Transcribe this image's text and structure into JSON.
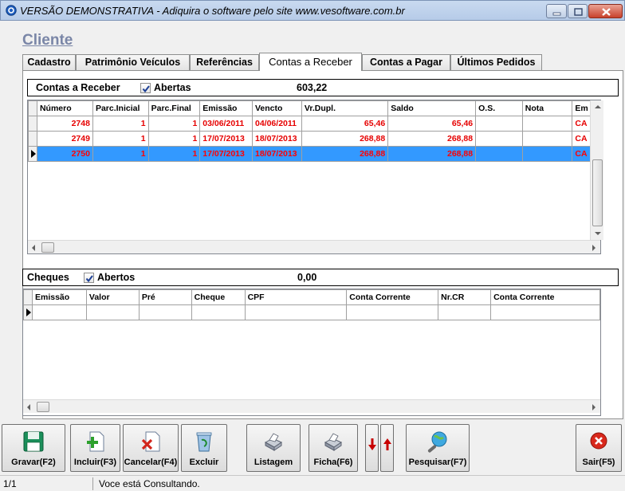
{
  "window": {
    "title": "VERSÃO DEMONSTRATIVA - Adiquira o software pelo site www.vesoftware.com.br",
    "icons": [
      "app-icon",
      "minimize-icon",
      "maximize-icon",
      "close-icon"
    ]
  },
  "page_title": "Cliente",
  "tabs": [
    {
      "label": "Cadastro",
      "active": false
    },
    {
      "label": "Patrimônio Veículos",
      "active": false
    },
    {
      "label": "Referências",
      "active": false
    },
    {
      "label": "Contas a Receber",
      "active": true
    },
    {
      "label": "Contas a Pagar",
      "active": false
    },
    {
      "label": "Últimos Pedidos",
      "active": false
    }
  ],
  "receivables": {
    "label": "Contas a Receber",
    "checkbox_label": "Abertas",
    "checked": true,
    "total": "603,22",
    "columns": [
      "Número",
      "Parc.Inicial",
      "Parc.Final",
      "Emissão",
      "Vencto",
      "Vr.Dupl.",
      "Saldo",
      "O.S.",
      "Nota",
      "Em"
    ],
    "rows": [
      [
        "2748",
        "1",
        "1",
        "03/06/2011",
        "04/06/2011",
        "65,46",
        "65,46",
        "",
        "",
        "CA"
      ],
      [
        "2749",
        "1",
        "1",
        "17/07/2013",
        "18/07/2013",
        "268,88",
        "268,88",
        "",
        "",
        "CA"
      ],
      [
        "2750",
        "1",
        "1",
        "17/07/2013",
        "18/07/2013",
        "268,88",
        "268,88",
        "",
        "",
        "CA"
      ]
    ],
    "selected_row": 2
  },
  "cheques": {
    "label": "Cheques",
    "checkbox_label": "Abertos",
    "checked": true,
    "total": "0,00",
    "columns": [
      "Emissão",
      "Valor",
      "Pré",
      "Cheque",
      "CPF",
      "Conta Corrente",
      "Nr.CR",
      "Conta Corrente"
    ]
  },
  "toolbar": {
    "save": "Gravar(F2)",
    "insert": "Incluir(F3)",
    "cancel": "Cancelar(F4)",
    "delete": "Excluir",
    "list": "Listagem",
    "sheet": "Ficha(F6)",
    "search": "Pesquisar(F7)",
    "exit": "Sair(F5)"
  },
  "status": {
    "record": "1/1",
    "message": "Voce está Consultando."
  }
}
